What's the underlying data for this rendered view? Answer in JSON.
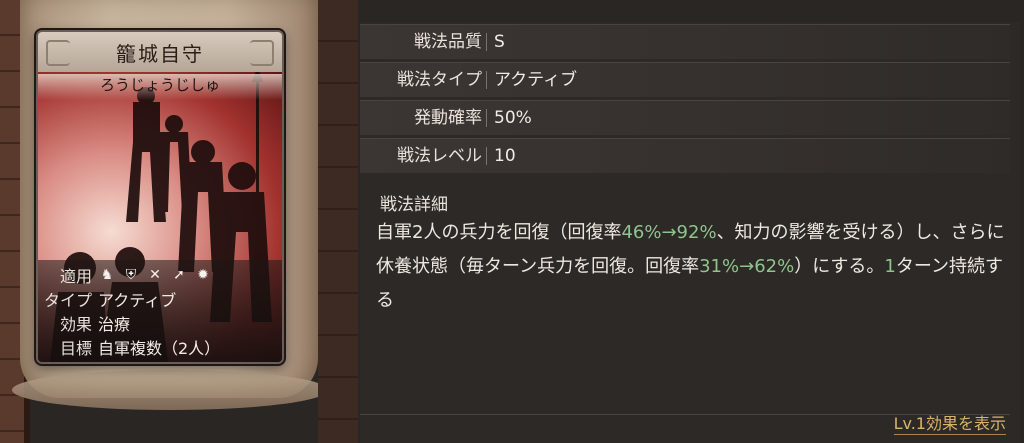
{
  "card": {
    "title": "籠城自守",
    "reading": "ろうじょうじしゅ",
    "apply_label": "適用",
    "apply_icons": [
      "horse-icon",
      "shield-icon",
      "bow-icon",
      "spear-icon",
      "wheel-icon"
    ],
    "type_label": "タイプ",
    "type_value": "アクティブ",
    "effect_label": "効果",
    "effect_value": "治療",
    "target_label": "目標",
    "target_value": "自軍複数（2人）"
  },
  "stats": [
    {
      "label": "戦法品質",
      "value": "S"
    },
    {
      "label": "戦法タイプ",
      "value": "アクティブ"
    },
    {
      "label": "発動確率",
      "value": "50%"
    },
    {
      "label": "戦法レベル",
      "value": "10"
    }
  ],
  "detail": {
    "label": "戦法詳細",
    "t1": "自軍2人の兵力を回復（回復率",
    "g1": "46%→92%",
    "t2": "、知力の影響を受ける）し、さらに休養状態（毎ターン兵力を回復。回復率",
    "g2": "31%→62%",
    "t3": "）にする。",
    "g3": "1",
    "t4": "ターン持続する"
  },
  "link_label": "Lv.1効果を表示",
  "colors": {
    "highlight": "#8fc48d",
    "link": "#d8b46a"
  }
}
